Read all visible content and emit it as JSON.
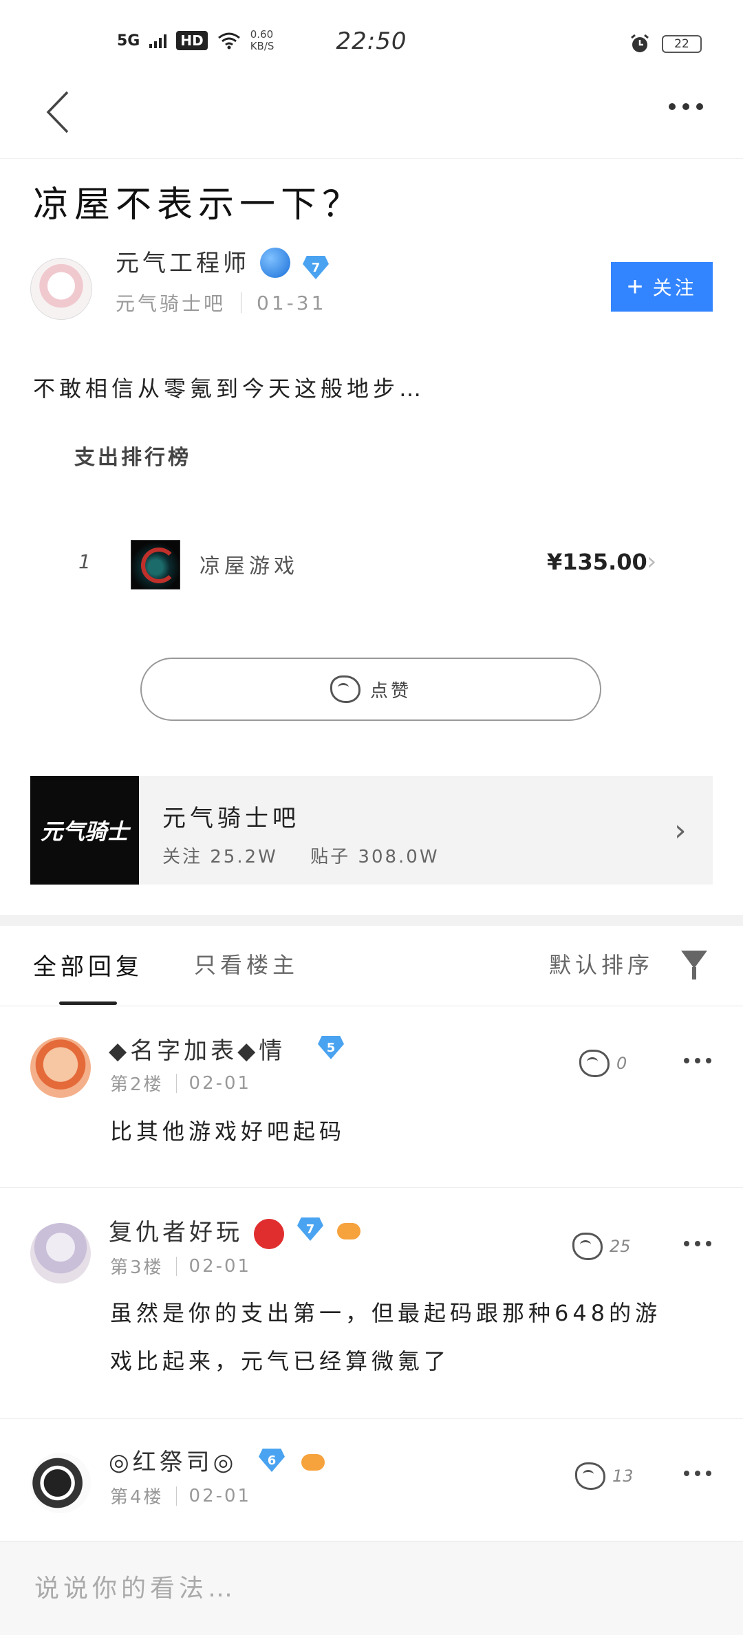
{
  "status_bar": {
    "network": "5G",
    "hd": "HD",
    "speed_value": "0.60",
    "speed_unit": "KB/S",
    "time": "22:50",
    "battery": "22"
  },
  "post": {
    "title": "凉屋不表示一下？",
    "author": {
      "name": "元气工程师",
      "level": "7",
      "forum": "元气骑士吧",
      "date": "01-31"
    },
    "follow_label": "关注",
    "body": "不敢相信从零氪到今天这般地步…",
    "ranking": {
      "title": "支出排行榜",
      "items": [
        {
          "rank": "1",
          "name": "凉屋游戏",
          "amount": "¥135.00"
        }
      ]
    },
    "like_label": "点赞"
  },
  "forum_card": {
    "logo_text": "元气骑士",
    "name": "元气骑士吧",
    "followers": "关注 25.2W",
    "posts": "贴子 308.0W"
  },
  "tabs": {
    "all_replies": "全部回复",
    "op_only": "只看楼主",
    "sort": "默认排序"
  },
  "replies": [
    {
      "name": "◆名字加表◆情",
      "level": "5",
      "floor": "第2楼",
      "date": "02-01",
      "likes": "0",
      "text": "比其他游戏好吧起码"
    },
    {
      "name": "复仇者好玩",
      "level": "7",
      "floor": "第3楼",
      "date": "02-01",
      "likes": "25",
      "text_line1": "虽然是你的支出第一，但最起码跟那种648的游",
      "text_line2": "戏比起来，元气已经算微氪了"
    },
    {
      "name": "◎红祭司◎",
      "level": "6",
      "floor": "第4楼",
      "date": "02-01",
      "likes": "13"
    }
  ],
  "comment": {
    "placeholder": "说说你的看法…"
  },
  "colors": {
    "accent": "#3385ff",
    "level_badge": "#4aa3f0"
  }
}
